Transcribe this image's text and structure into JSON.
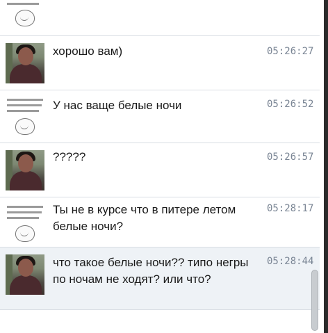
{
  "messages": [
    {
      "id": 0,
      "avatar": "meme-avatar",
      "text": "",
      "time": ""
    },
    {
      "id": 1,
      "avatar": "photo-avatar",
      "text": "хорошо вам)",
      "time": "05:26:27"
    },
    {
      "id": 2,
      "avatar": "meme-avatar",
      "text": "У нас ваще белые ночи",
      "time": "05:26:52"
    },
    {
      "id": 3,
      "avatar": "photo-avatar",
      "text": "?????",
      "time": "05:26:57"
    },
    {
      "id": 4,
      "avatar": "meme-avatar",
      "text": "Ты не в курсе что в питере летом белые ночи?",
      "time": "05:28:17"
    },
    {
      "id": 5,
      "avatar": "photo-avatar",
      "text": "что такое белые ночи?? типо негры по ночам не ходят? или что?",
      "time": "05:28:44"
    }
  ]
}
